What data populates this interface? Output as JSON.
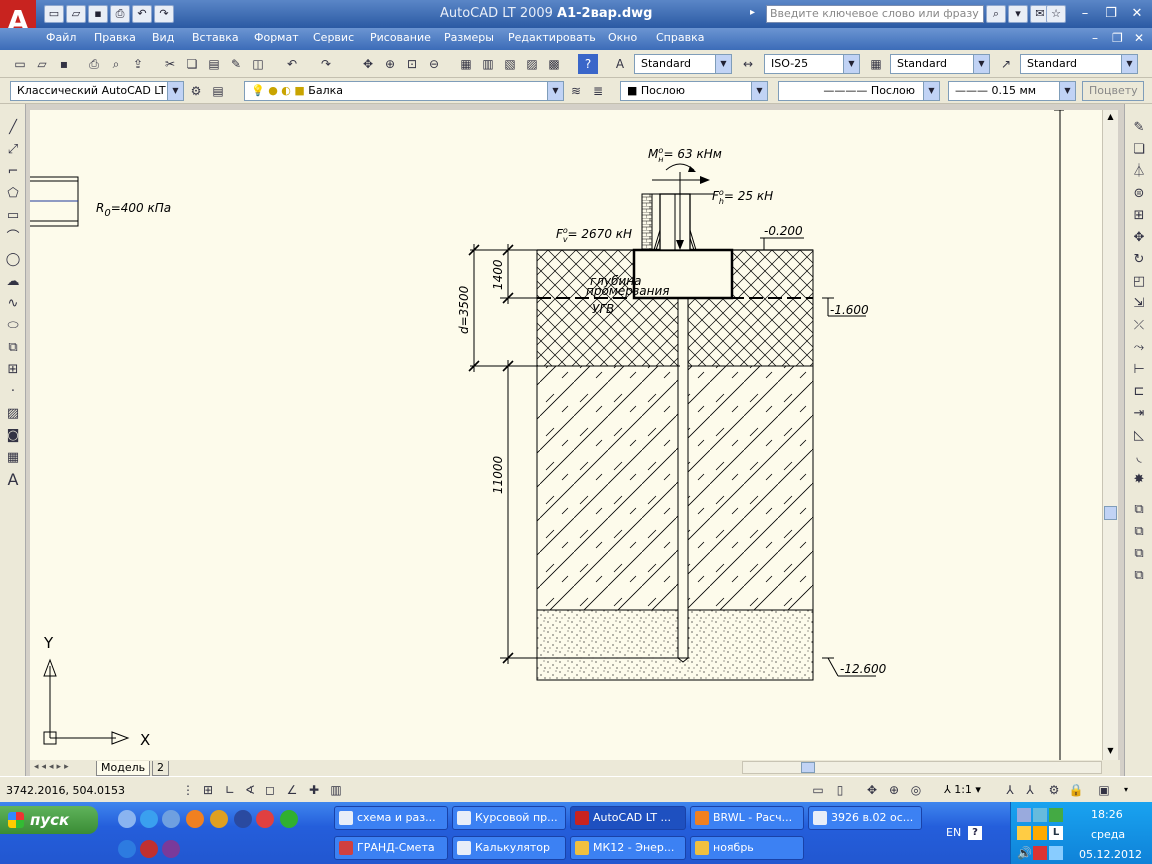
{
  "window": {
    "app_title": "AutoCAD LT 2009",
    "file_title": "А1-2вар.dwg",
    "search_placeholder": "Введите ключевое слово или фразу",
    "logo": "A"
  },
  "menu": [
    "Файл",
    "Правка",
    "Вид",
    "Вставка",
    "Формат",
    "Сервис",
    "Рисование",
    "Размеры",
    "Редактировать",
    "Окно",
    "Справка"
  ],
  "toolbar1": {
    "text_style": "Standard",
    "dim_style": "ISO-25",
    "table_style": "Standard",
    "mleader_style": "Standard"
  },
  "toolbar2": {
    "workspace": "Классический AutoCAD LT",
    "layer": "Балка",
    "color": "Послою",
    "linetype": "Послою",
    "lineweight": "0.15 мм",
    "plotstyle": "Поцвету"
  },
  "tabs": {
    "model": "Модель",
    "layout": "2"
  },
  "status": {
    "coords": "3742.2016, 504.0153",
    "scale": "1:1"
  },
  "drawing": {
    "r0": "R",
    "r0_sub": "0",
    "r0_value": "=400 кПа",
    "moment_label": "M",
    "moment_sup": "o",
    "moment_sub": "н",
    "moment_value": "= 63 кНм",
    "fh_label": "F",
    "fh_sup": "o",
    "fh_sub": "h",
    "fh_value": "= 25 кН",
    "fv_label": "F",
    "fv_sup": "o",
    "fv_sub": "v",
    "fv_value": "= 2670 кН",
    "level_top": "-0.200",
    "level_mid": "-1.600",
    "level_bot": "-12.600",
    "frost1": "глубина",
    "frost2": "промерзания",
    "gwl": "УГВ",
    "dim_1400": "1400",
    "dim_d": "d=3500",
    "dim_11000": "11000",
    "axis_x": "X",
    "axis_y": "Y"
  },
  "taskbar": {
    "start": "пуск",
    "tasks_row1": [
      "схема и раз...",
      "Курсовой пр...",
      "AutoCAD LT ...",
      "BRWL - Расч...",
      "3926 в.02 ос..."
    ],
    "tasks_row2": [
      "ГРАНД-Смета",
      "Калькулятор",
      "МК12 - Энер...",
      "ноябрь"
    ],
    "lang": "EN",
    "time": "18:26",
    "day": "среда",
    "date": "05.12.2012"
  },
  "colors": {
    "canvas_bg": "#fdfbeb",
    "title_bar": "#2b5aa3",
    "taskbar": "#245edb",
    "start_green": "#3a8c35"
  }
}
